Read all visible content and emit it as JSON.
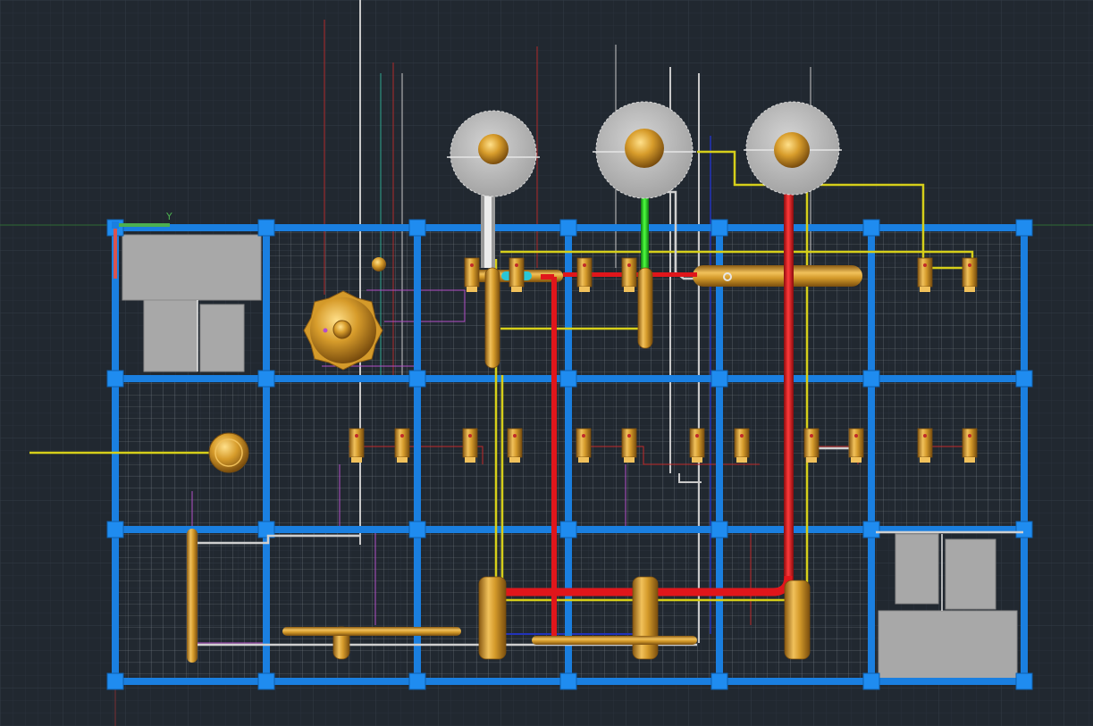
{
  "viewport": {
    "background": "#212830",
    "grid_minor_color": "#2a323c",
    "grid_major_color": "#333c47"
  },
  "ucs_icon": {
    "x_label": "",
    "y_label": "Y",
    "x_axis_color": "#4caf50",
    "y_axis_color": "#d9534f"
  },
  "colors": {
    "frame_blue": "#1a7fe0",
    "pipe_copper": "#d49a2a",
    "pipe_copper_dark": "#8a5a12",
    "pipe_red": "#e0161b",
    "pipe_green": "#22c81e",
    "pipe_white": "#c8c8c8",
    "pipe_yellow": "#d6cf1a",
    "pipe_cyan": "#29c6d6",
    "equipment_gray": "#a8a8a8",
    "wire_white": "#b9c0c6",
    "wire_magenta": "#b44fc8",
    "wire_red": "#c22a2a",
    "wire_blue": "#2233bb"
  },
  "model": {
    "frame_label": "structural-frame",
    "tanks": [
      {
        "name": "tank-left"
      },
      {
        "name": "tank-center"
      },
      {
        "name": "tank-right"
      }
    ]
  }
}
